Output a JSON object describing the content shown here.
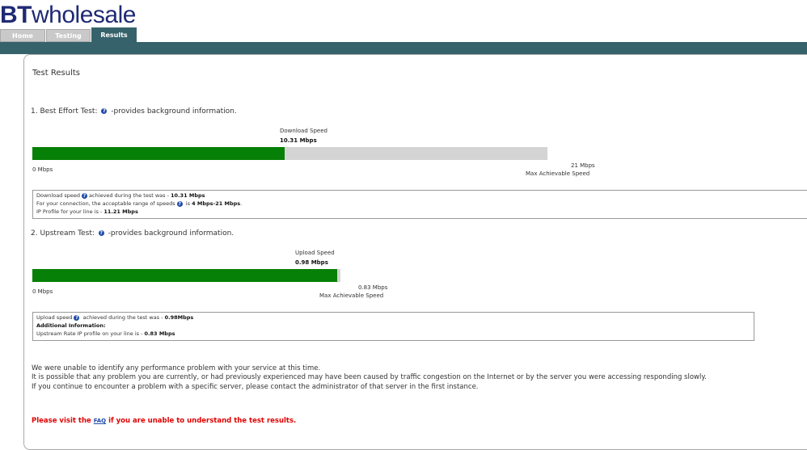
{
  "brand": {
    "bt": "BT",
    "wholesale": "wholesale"
  },
  "tabs": [
    {
      "label": "Home"
    },
    {
      "label": "Testing"
    },
    {
      "label": "Results"
    }
  ],
  "page_title": "Test Results",
  "help_icon": "question-icon",
  "best_effort": {
    "heading_prefix": "1. Best Effort Test:",
    "heading_suffix": "-provides background information.",
    "bar_label": "Download  Speed",
    "bar_value": "10.31 Mbps",
    "fill_fraction": 0.49,
    "min_label": "0 Mbps",
    "max_value": "21 Mbps",
    "max_label": "Max Achievable Speed",
    "info": {
      "line1_a": "Download speed",
      "line1_b": "achieved during the test was -",
      "line1_value": "10.31 Mbps",
      "line2_a": "For your connection, the acceptable range of speeds",
      "line2_b": "is",
      "line2_value": "4 Mbps-21 Mbps",
      "line2_end": ".",
      "line3_a": "IP Profile for your line is -",
      "line3_value": "11.21 Mbps"
    }
  },
  "upstream": {
    "heading_prefix": "2. Upstream Test:",
    "heading_suffix": "-provides background information.",
    "bar_label": "Upload Speed",
    "bar_value": "0.98 Mbps",
    "fill_fraction": 0.99,
    "min_label": "0 Mbps",
    "max_value": "0.83 Mbps",
    "max_label": "Max Achievable Speed",
    "info": {
      "line1_a": "Upload speed",
      "line1_b": "achieved during the test was -",
      "line1_value": "0.98Mbps",
      "line2": "Additional Information:",
      "line3_a": "Upstream Rate IP profile on your line is -",
      "line3_value": "0.83 Mbps"
    }
  },
  "messages": [
    "We were unable to identify any performance problem with your service at this time.",
    "It is possible that any problem you are currently, or had previously experienced may have been caused by traffic congestion on the Internet or by the server you were accessing responding slowly.",
    "If you continue to encounter a problem with a specific server, please contact the administrator of that server in the first instance."
  ],
  "faq": {
    "prefix": "Please visit the",
    "link": "FAQ",
    "suffix": "if you are unable to understand the test results."
  },
  "colors": {
    "brand": "#1f2a74",
    "strip": "#36636b",
    "fill": "#068006",
    "track": "#d4d4d4",
    "warning": "#e00000"
  }
}
